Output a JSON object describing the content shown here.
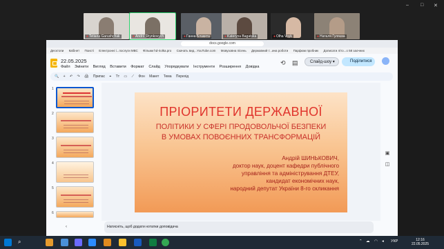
{
  "participants": [
    {
      "name": "Tetiana Garushchak",
      "active": false
    },
    {
      "name": "Andrii Shynkovych",
      "active": true
    },
    {
      "name": "Ганна Блакита",
      "active": false
    },
    {
      "name": "Kateryna Bagatska",
      "active": false
    },
    {
      "name": "Olha Voyk",
      "active": false
    },
    {
      "name": "Наталя Гуляєва",
      "active": false
    }
  ],
  "browser": {
    "url": "docs.google.com",
    "bookmarks": [
      "Десктопи",
      "Кабінет",
      "Поисті",
      "Електронні і...послуги МВС",
      "Фільми hd-riolka.pro",
      "Скачать вид...YouTube.com",
      "Мовузовна пісень",
      "Державний т...ина роботи",
      "Парфюм пробник",
      "Дописати літо...о 58 заочних"
    ]
  },
  "doc": {
    "title": "22.05.2025",
    "menus": [
      "Файл",
      "Змінити",
      "Вигляд",
      "Вставити",
      "Формат",
      "Слайд",
      "Упорядкувати",
      "Інструменти",
      "Розширення",
      "Довідка"
    ],
    "slideshow_label": "Слайд-шоу",
    "share_label": "Поділитися",
    "toolbar_items": [
      "+",
      "↶",
      "↷",
      "🖨",
      "Припас",
      "⌖",
      "Tт",
      "▭",
      "⟋",
      "Фон",
      "Макет",
      "Тема",
      "Перехід"
    ],
    "notes_placeholder": "Натисніть, щоб додати нотатки доповідача",
    "slide_numbers": [
      "1",
      "2",
      "3",
      "4",
      "5",
      "6"
    ]
  },
  "slide": {
    "title": "ПРІОРИТЕТИ ДЕРЖАВНОЇ",
    "subtitle1": "ПОЛІТИКИ У СФЕРІ ПРОДОВОЛЬЧОЇ БЕЗПЕКИ",
    "subtitle2": "В УМОВАХ ПОВОЄННИХ ТРАНСФОРМАЦІЙ",
    "author_lines": [
      "Андрій ШИНЬКОВИЧ,",
      "доктор наук, доцент кафедри публічного",
      "управління та адміністрування ДТЕУ,",
      "кандидат економічних наук,",
      "народний депутат України 8-го скликання"
    ]
  },
  "taskbar": {
    "lang": "УКР",
    "time": "12:16",
    "date": "22.05.2025"
  }
}
